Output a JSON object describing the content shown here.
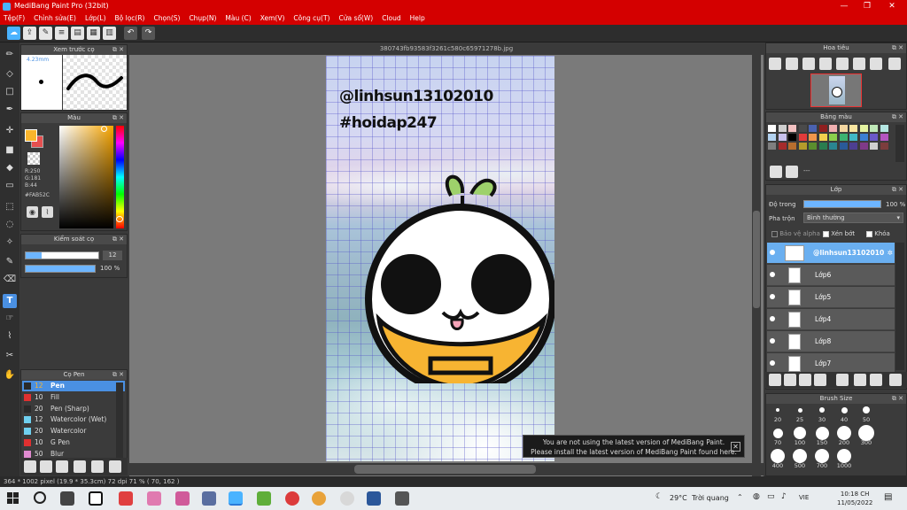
{
  "window": {
    "title": "MediBang Paint Pro (32bit)",
    "min": "—",
    "max": "❐",
    "close": "✕"
  },
  "menu": [
    "Tệp(F)",
    "Chỉnh sửa(E)",
    "Lớp(L)",
    "Bộ lọc(R)",
    "Chọn(S)",
    "Chụp(N)",
    "Màu (C)",
    "Xem(V)",
    "Công cụ(T)",
    "Cửa sổ(W)",
    "Cloud",
    "Help"
  ],
  "document": {
    "filename": "380743fb93583f3261c580c65971278b.jpg"
  },
  "image_text": {
    "line1": "@linhsun13102010",
    "line2": "#hoidap247"
  },
  "preview_panel": {
    "title": "Xem trước cọ",
    "size": "4.23mm"
  },
  "color_panel": {
    "title": "Màu",
    "r": "R:250",
    "g": "G:181",
    "b": "B:44",
    "hex": "#FAB52C",
    "primary_color": "#FAB52C",
    "secondary_color": "#E55050"
  },
  "brush_control": {
    "title": "Kiểm soát cọ",
    "size": "12",
    "opacity": "100 %"
  },
  "brush_panel": {
    "title": "Cọ Pen",
    "items": [
      {
        "size": "12",
        "name": "Pen",
        "color": "#2a2a2a",
        "selected": true
      },
      {
        "size": "10",
        "name": "Fill",
        "color": "#e03030"
      },
      {
        "size": "20",
        "name": "Pen (Sharp)",
        "color": "#2a2a2a"
      },
      {
        "size": "12",
        "name": "Watercolor (Wet)",
        "color": "#6fd0f0"
      },
      {
        "size": "20",
        "name": "Watercolor",
        "color": "#6fd0f0"
      },
      {
        "size": "10",
        "name": "G Pen",
        "color": "#e03030"
      },
      {
        "size": "50",
        "name": "Blur",
        "color": "#e08ad0"
      }
    ]
  },
  "navigator": {
    "title": "Hoa tiêu"
  },
  "palette": {
    "title": "Bảng màu",
    "label": "---",
    "colors": [
      "#ffffff",
      "#cfcfcf",
      "#f3c2c2",
      "#4a4a4a",
      "#4a62b0",
      "#8f1f1f",
      "#f1b0b0",
      "#f3d6a0",
      "#f9e6a0",
      "#e4f3a0",
      "#bfe8b8",
      "#b4e6e2",
      "#b2d2f0",
      "#c7c1ec",
      "#000000",
      "#e23b3b",
      "#f0964b",
      "#f1cf4d",
      "#8bd04c",
      "#3cb271",
      "#41b8c6",
      "#3b7fd2",
      "#6a59c8",
      "#b455c1",
      "#7f7f7f",
      "#a52b2b",
      "#b86e2e",
      "#b59b2b",
      "#5a8e2e",
      "#2a7d4f",
      "#2a8591",
      "#2a5a98",
      "#4d3f91",
      "#7f3a88",
      "#d0d0d0",
      "#7c3d3d"
    ]
  },
  "layer_panel": {
    "title": "Lớp",
    "opacity_label": "Độ trong",
    "opacity_value": "100 %",
    "blend_label": "Pha trộn",
    "blend_value": "Bình thường",
    "protect_alpha": "Bảo vệ alpha",
    "clipping": "Xén bớt",
    "lock": "Khóa",
    "layers": [
      {
        "name": "@linhsun13102010",
        "selected": true
      },
      {
        "name": "Lớp6"
      },
      {
        "name": "Lớp5"
      },
      {
        "name": "Lớp4"
      },
      {
        "name": "Lớp8"
      },
      {
        "name": "Lớp7"
      }
    ]
  },
  "brush_size": {
    "title": "Brush Size",
    "sizes": [
      "20",
      "25",
      "30",
      "40",
      "50",
      "70",
      "100",
      "150",
      "200",
      "300",
      "400",
      "500",
      "700",
      "1000"
    ]
  },
  "notification": {
    "line1": "You are not using the latest version of MediBang Paint.",
    "line2": "Please install the latest version of MediBang Paint found here."
  },
  "status": {
    "text": "364 * 1002 pixel  (19.9 * 35.3cm)  72 dpi  71 %  ( 70, 162 )"
  },
  "taskbar": {
    "weather_temp": "29°C",
    "weather_desc": "Trời quang",
    "lang": "VIE",
    "time": "10:18 CH",
    "date": "11/05/2022"
  }
}
